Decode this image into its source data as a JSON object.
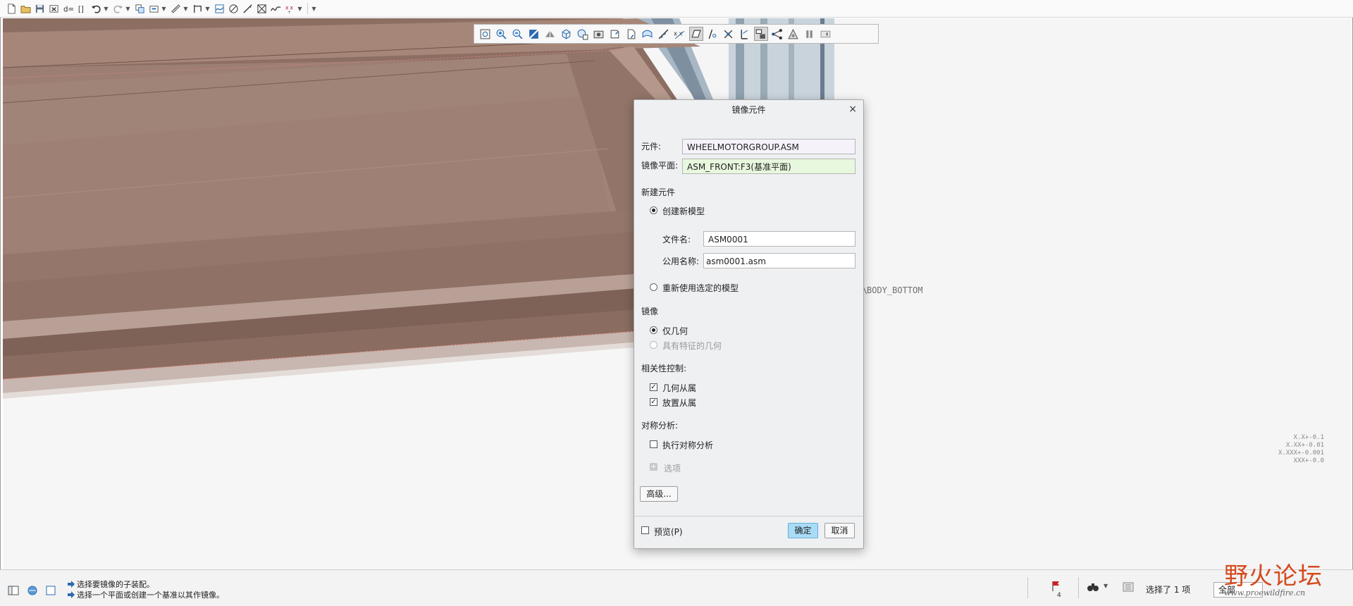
{
  "quick_access": {
    "icons": [
      "new-file",
      "open-folder",
      "save",
      "close-window",
      "regenerate",
      "relations",
      "undo",
      "redo",
      "copy-geometry",
      "rename",
      "measure",
      "datum-plane",
      "sketch",
      "point",
      "axis",
      "spline",
      "coordinate-system",
      "customize"
    ]
  },
  "graphics_toolbar": {
    "icons": [
      "refit",
      "zoom-in",
      "zoom-out",
      "repaint",
      "display-style",
      "saved-views",
      "view-manager",
      "perspective",
      "named-views",
      "annotations",
      "appearance",
      "datum-planes",
      "datum-axes",
      "datum-points",
      "coordinate-systems",
      "spin-center",
      "selection-filter",
      "plane-tags",
      "model-tree-toggle",
      "analysis",
      "shading",
      "pause",
      "next"
    ]
  },
  "viewport": {
    "annotation_text": "BODY_BOTTOM",
    "tolerance_table": [
      "X.X+-0.1",
      "X.XX+-0.01",
      "X.XXX+-0.001",
      "XXX+-0.0"
    ]
  },
  "dialog": {
    "title": "镜像元件",
    "close_symbol": "×",
    "component_label": "元件:",
    "component_value": "WHEELMOTORGROUP.ASM",
    "mirror_plane_label": "镜像平面:",
    "mirror_plane_value": "ASM_FRONT:F3(基准平面)",
    "new_component_section": "新建元件",
    "create_new_model": "创建新模型",
    "file_name_label": "文件名:",
    "file_name_value": "ASM0001",
    "common_name_label": "公用名称:",
    "common_name_value": "asm0001.asm",
    "reuse_selected_model": "重新使用选定的模型",
    "mirror_section": "镜像",
    "geometry_only": "仅几何",
    "geometry_with_features": "具有特征的几何",
    "dependency_section": "相关性控制:",
    "geometry_dependent": "几何从属",
    "placement_dependent": "放置从属",
    "symmetry_section": "对称分析:",
    "run_symmetry_analysis": "执行对称分析",
    "options": "选项",
    "advanced_button": "高级...",
    "preview_label": "预览(P)",
    "ok_button": "确定",
    "cancel_button": "取消"
  },
  "status_bar": {
    "messages": [
      "选择要镜像的子装配。",
      "选择一个平面或创建一个基准以其作镜像。"
    ],
    "flag_count": "4",
    "selection_count": "选择了 1 项",
    "filter_value": "全部"
  },
  "watermark": {
    "text": "野火论坛",
    "url": "www.proewildfire.cn"
  },
  "colors": {
    "dialog_bg": "#eef0f2",
    "primary_button": "#a9dcf7",
    "plane_field": "#e8f8de",
    "annotation_red": "#e0101c",
    "model_surface": "#9e8174"
  }
}
